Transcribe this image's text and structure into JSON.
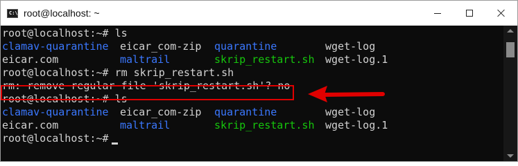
{
  "window": {
    "title": "root@localhost: ~",
    "icon": "terminal-icon",
    "controls": [
      "minimize-icon",
      "maximize-icon",
      "close-icon"
    ]
  },
  "colors": {
    "background": "#0c0c0c",
    "text": "#d2d2d2",
    "directory": "#3b78ff",
    "executable": "#16c60c",
    "annotation": "#e00000"
  },
  "terminal": {
    "prompt": "root@localhost:~#",
    "lines": [
      {
        "type": "command",
        "command": "ls"
      },
      {
        "type": "listing",
        "items": [
          "clamav-quarantine",
          "eicar_com-zip",
          "quarantine",
          "wget-log"
        ]
      },
      {
        "type": "listing",
        "items": [
          "eicar.com",
          "maltrail",
          "skrip_restart.sh",
          "wget-log.1"
        ]
      },
      {
        "type": "command",
        "command": "rm skrip_restart.sh"
      },
      {
        "type": "output",
        "text": "rm: remove regular file 'skrip_restart.sh'? no"
      },
      {
        "type": "command",
        "command": "ls"
      },
      {
        "type": "listing",
        "items": [
          "clamav-quarantine",
          "eicar_com-zip",
          "quarantine",
          "wget-log"
        ]
      },
      {
        "type": "listing",
        "items": [
          "eicar.com",
          "maltrail",
          "skrip_restart.sh",
          "wget-log.1"
        ]
      },
      {
        "type": "command",
        "command": ""
      }
    ]
  }
}
